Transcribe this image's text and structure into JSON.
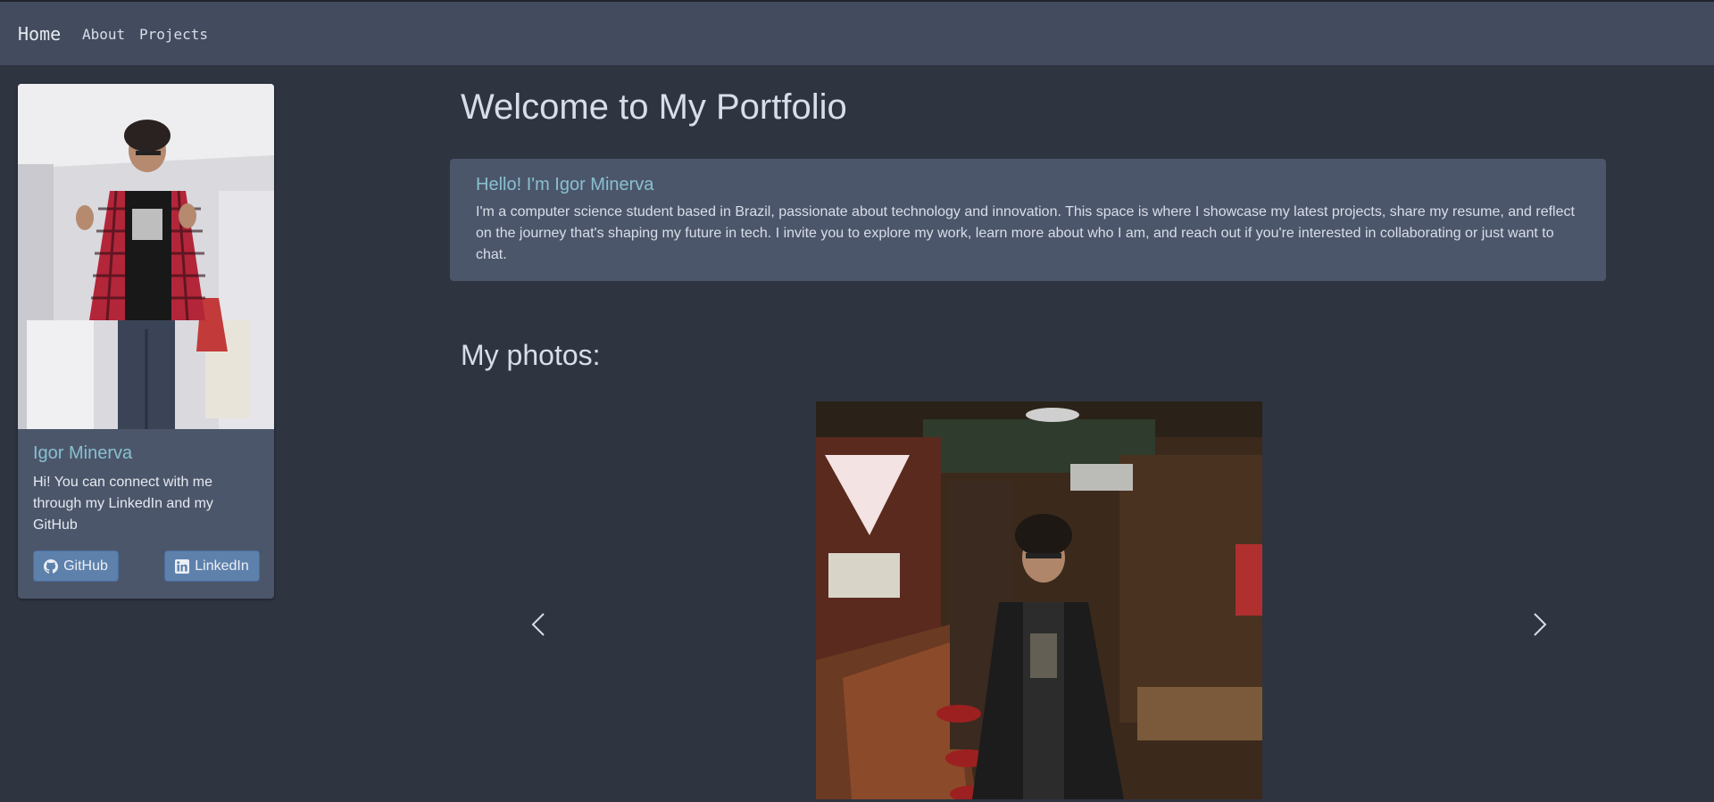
{
  "navbar": {
    "brand": "Home",
    "links": [
      {
        "label": "About"
      },
      {
        "label": "Projects"
      }
    ]
  },
  "sidebar": {
    "name": "Igor Minerva",
    "text": "Hi! You can connect with me through my LinkedIn and my GitHub",
    "buttons": {
      "github": "GitHub",
      "linkedin": "LinkedIn"
    }
  },
  "main": {
    "title": "Welcome to My Portfolio",
    "intro": {
      "heading": "Hello! I'm Igor Minerva",
      "text": "I'm a computer science student based in Brazil, passionate about technology and innovation. This space is where I showcase my latest projects, share my resume, and reflect on the journey that's shaping my future in tech. I invite you to explore my work, learn more about who I am, and reach out if you're interested in collaborating or just want to chat."
    },
    "photos_title": "My photos:"
  },
  "icons": {
    "github": "github-icon",
    "linkedin": "linkedin-icon",
    "prev": "chevron-left-icon",
    "next": "chevron-right-icon"
  },
  "colors": {
    "background": "#2e3440",
    "navbar": "#434c5e",
    "card": "#4c566a",
    "accent": "#88c0d0",
    "button": "#5e81ac"
  }
}
